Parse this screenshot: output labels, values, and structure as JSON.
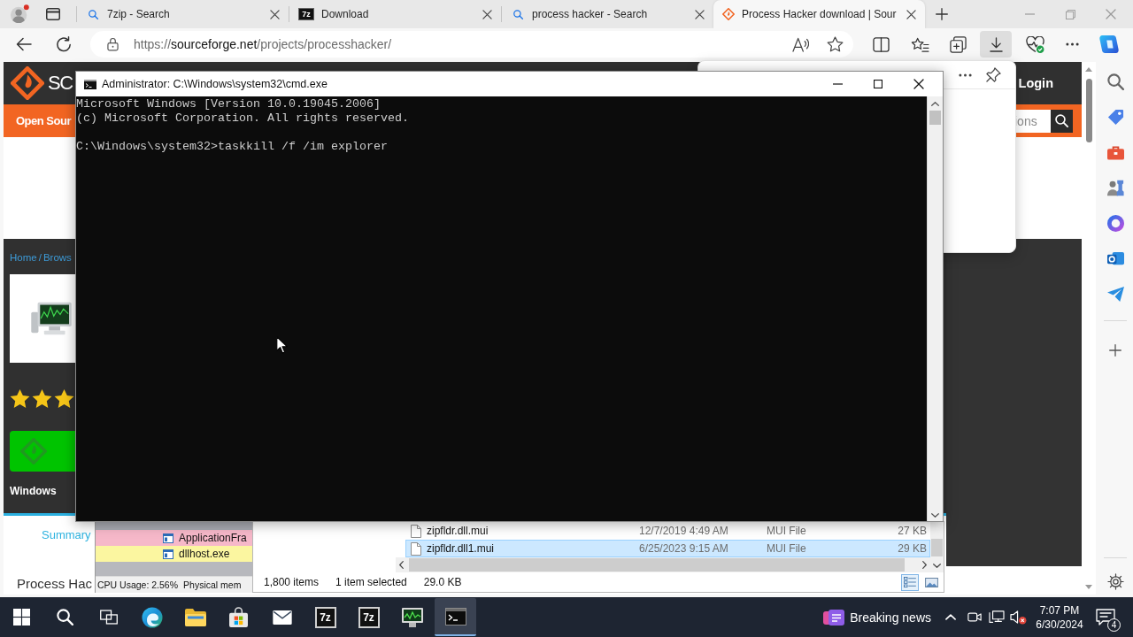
{
  "browser": {
    "tabs": [
      {
        "title": "7zip - Search",
        "kind": "search",
        "selected": false
      },
      {
        "title": "Download",
        "kind": "logo",
        "logo": "7z",
        "selected": false
      },
      {
        "title": "process hacker - Search",
        "kind": "search",
        "selected": false
      },
      {
        "title": "Process Hacker download | Sour",
        "kind": "site",
        "selected": true
      }
    ],
    "address": {
      "scheme": "https://",
      "host": "sourceforge.net",
      "path": "/projects/processhacker/"
    },
    "downloads_active": true
  },
  "page": {
    "logo_text": "SC",
    "login": "Login",
    "nav_item": "Open Sour",
    "search_placeholder": "ions",
    "breadcrumb": [
      "Home",
      "Brows"
    ],
    "breadcrumb_separator": "/",
    "rating": {
      "stars": 3
    },
    "platform": "Windows",
    "section_tab": "Summary",
    "title": "Process Hac"
  },
  "process_hacker": {
    "rows": [
      {
        "color": "#a9abb2"
      },
      {
        "name": "ApplicationFra",
        "color": "#f6b8c9"
      },
      {
        "name": "dllhost.exe",
        "color": "#fbf6a0"
      },
      {
        "color": "#b7b8bd"
      }
    ],
    "status": [
      "CPU Usage: 2.56%",
      "Physical mem"
    ]
  },
  "explorer": {
    "files": [
      {
        "name": "zipfldr.dll.mui",
        "date": "12/7/2019 4:49 AM",
        "type": "MUI File",
        "size": "27 KB",
        "selected": false
      },
      {
        "name": "zipfldr.dll1.mui",
        "date": "6/25/2023 9:15 AM",
        "type": "MUI File",
        "size": "29 KB",
        "selected": true
      }
    ],
    "item_count": "1,800 items",
    "selection": "1 item selected",
    "selection_size": "29.0 KB",
    "views": [
      {
        "kind": "details",
        "selected": true
      },
      {
        "kind": "tiles",
        "selected": false
      }
    ]
  },
  "cmd": {
    "title": "Administrator: C:\\Windows\\system32\\cmd.exe",
    "paragraphs": [
      [
        "Microsoft Windows [Version 10.0.19045.2006]",
        "(c) Microsoft Corporation. All rights reserved."
      ],
      [
        "C:\\Windows\\system32>taskkill /f /im explorer"
      ]
    ]
  },
  "taskbar": {
    "apps": [
      {
        "kind": "start",
        "active": false
      },
      {
        "kind": "search",
        "active": false
      },
      {
        "kind": "taskview",
        "active": false
      },
      {
        "kind": "browser",
        "active": false
      },
      {
        "kind": "folder",
        "active": false
      },
      {
        "kind": "store",
        "active": false
      },
      {
        "kind": "mail",
        "active": false
      },
      {
        "kind": "logo",
        "label": "7z",
        "active": false
      },
      {
        "kind": "logo",
        "label": "7z",
        "active": false
      },
      {
        "kind": "monitor",
        "active": false
      },
      {
        "kind": "terminal",
        "active": true
      }
    ],
    "news": "Breaking news",
    "time": "7:07 PM",
    "date": "6/30/2024",
    "notifications": "4"
  }
}
